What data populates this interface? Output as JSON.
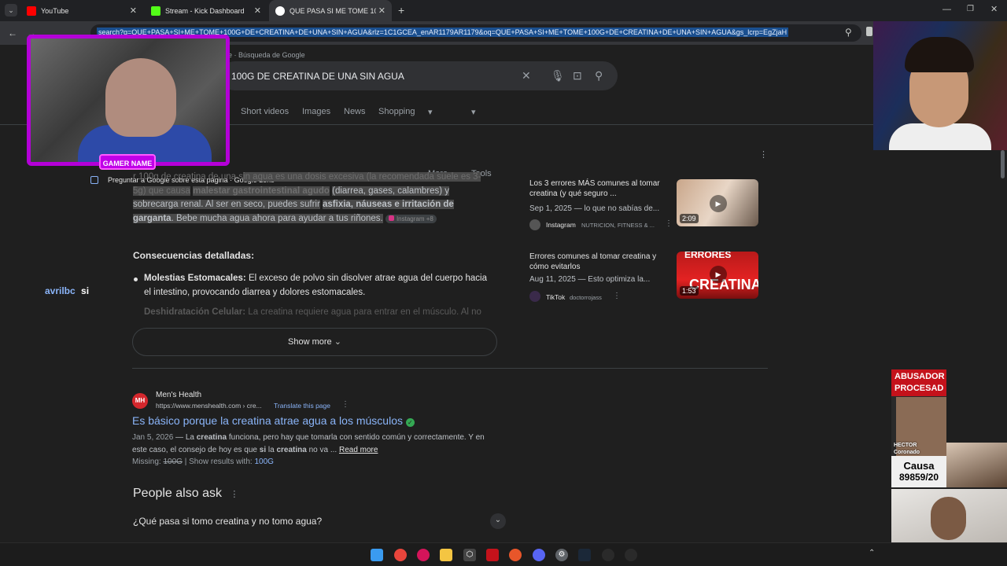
{
  "tabs": [
    {
      "label": "YouTube",
      "color": "#ff0000"
    },
    {
      "label": "Stream - Kick Dashboard",
      "color": "#53fc18"
    },
    {
      "label": "QUE PASA SI ME TOME 100G D",
      "color": "#4285f4"
    }
  ],
  "new_tab": "+",
  "url": "search?q=QUE+PASA+SI+ME+TOME+100G+DE+CREATINA+DE+UNA+SIN+AGUA&rlz=1C1GCEA_enAR1179AR1179&oq=QUE+PASA+SI+ME+TOME+100G+DE+CREATINA+DE+UNA+SIN+AGUA&gs_lcrp=EgZjaH",
  "url_prefix": "e · Búsqueda de Google",
  "search": {
    "query": "100G DE CREATINA DE UNA SIN AGUA"
  },
  "search_tabs": [
    "Short videos",
    "Images",
    "News",
    "Shopping",
    "More",
    "Tools"
  ],
  "overlay": {
    "gamer_name": "GAMER NAME",
    "chat_user": "avrilbc",
    "chat_msg": "si"
  },
  "ai": {
    "ask_google": "Preguntar a Google sobre esta página · Google Lens",
    "p1_a": "r 100g de creatina de una s",
    "p1_b": "in agua es una dosis excesiva (la recomendada suele es 3-5g) que causa",
    "p1_c": "malestar gastrointestinal agudo",
    "p1_d": "(diarrea, gases, calambres) y sobrecarga renal. Al ser en seco, puedes sufrir",
    "p1_e": "asfixia, náuseas e irritación de garganta",
    "p1_f": ". Bebe mucha agua ahora para ayudar a tus riñones.",
    "source_chip": "Instagram +8",
    "heading": "Consecuencias detalladas:",
    "b1_title": "Molestias Estomacales:",
    "b1_text": "El exceso de polvo sin disolver atrae agua del cuerpo hacia el intestino, provocando diarrea y dolores estomacales.",
    "b2_title": "Deshidratación Celular:",
    "b2_text": "La creatina requiere agua para entrar en el músculo. Al no",
    "show_more": "Show more"
  },
  "videos": [
    {
      "title": "Los 3 errores MÁS comunes al tomar creatina (y qué seguro ...",
      "date": "Sep 1, 2025 — lo que no sabías de...",
      "source": "Instagram",
      "author": "NUTRICION, FITNESS & ...",
      "duration": "2:09"
    },
    {
      "title": "Errores comunes al tomar creatina y cómo evitarlos",
      "date": "Aug 11, 2025 — Esto optimiza la...",
      "source": "TikTok",
      "author": "doctorrojass",
      "duration": "1:53",
      "thumb_text": "ERRORES",
      "thumb_text2": "CREATINA"
    }
  ],
  "result": {
    "site": "Men's Health",
    "favicon": "MH",
    "url": "https://www.menshealth.com › cre...",
    "translate": "Translate this page",
    "title": "Es básico porque la creatina atrae agua a los músculos",
    "date": "Jan 5, 2026",
    "snippet_a": " — La ",
    "snippet_b": "creatina",
    "snippet_c": " funciona, pero hay que tomarla con sentido común y correctamente. Y en este caso, el consejo de hoy es que ",
    "snippet_d": "si",
    "snippet_e": " la ",
    "snippet_f": "creatina",
    "snippet_g": " no va ...",
    "read_more": "Read more",
    "missing_label": "Missing:",
    "missing_word": "100G",
    "show_with": "Show results with:",
    "show_with_word": "100G"
  },
  "paa": {
    "heading": "People also ask",
    "q1": "¿Qué pasa si tomo creatina y no tomo agua?"
  },
  "side_overlay": {
    "banner1": "ABUSADOR",
    "banner2": "PROCESAD",
    "name1": "HECTOR",
    "name2": "Coronado",
    "causa": "Causa",
    "number": "89859/20"
  }
}
